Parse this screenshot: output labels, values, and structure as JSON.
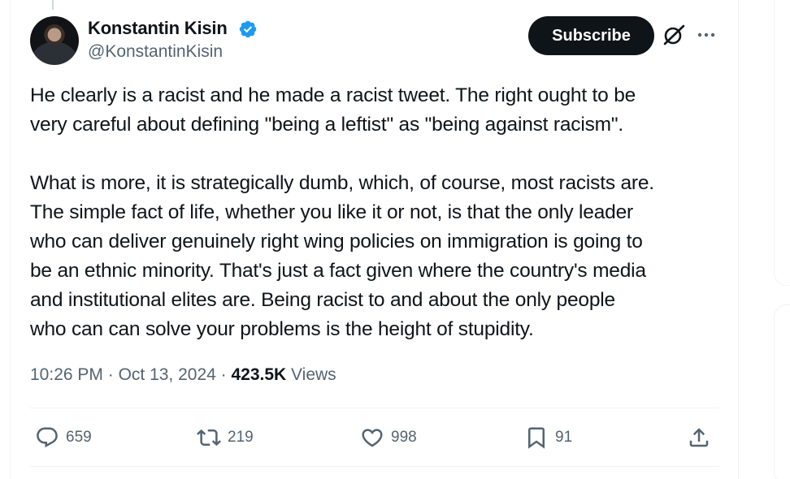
{
  "author": {
    "display_name": "Konstantin Kisin",
    "handle": "@KonstantinKisin",
    "verified": true,
    "verified_color": "#1d9bf0"
  },
  "header": {
    "subscribe_label": "Subscribe",
    "grok_icon": "grok-icon",
    "more_icon": "more-horizontal-icon"
  },
  "tweet": {
    "paragraphs": [
      "He clearly is a racist and he made a racist tweet. The right ought to be\nvery careful about defining \"being a leftist\" as \"being against racism\".",
      "What is more, it is strategically dumb, which, of course, most racists are.\nThe simple fact of life, whether you like it or not, is that the only leader\nwho can deliver genuinely right wing policies on immigration is going to\nbe an ethnic minority. That's just a fact given where the country's media\nand institutional elites are. Being racist to and about the only people\nwho can can solve your problems is the height of stupidity."
    ]
  },
  "meta": {
    "time": "10:26 PM",
    "separator": " · ",
    "date": "Oct 13, 2024",
    "views_count": "423.5K",
    "views_label": " Views"
  },
  "actions": {
    "replies": "659",
    "reposts": "219",
    "likes": "998",
    "bookmarks": "91"
  },
  "colors": {
    "text_primary": "#0f1419",
    "text_secondary": "#536471",
    "border": "#eff3f4",
    "button_bg": "#0f1419"
  }
}
